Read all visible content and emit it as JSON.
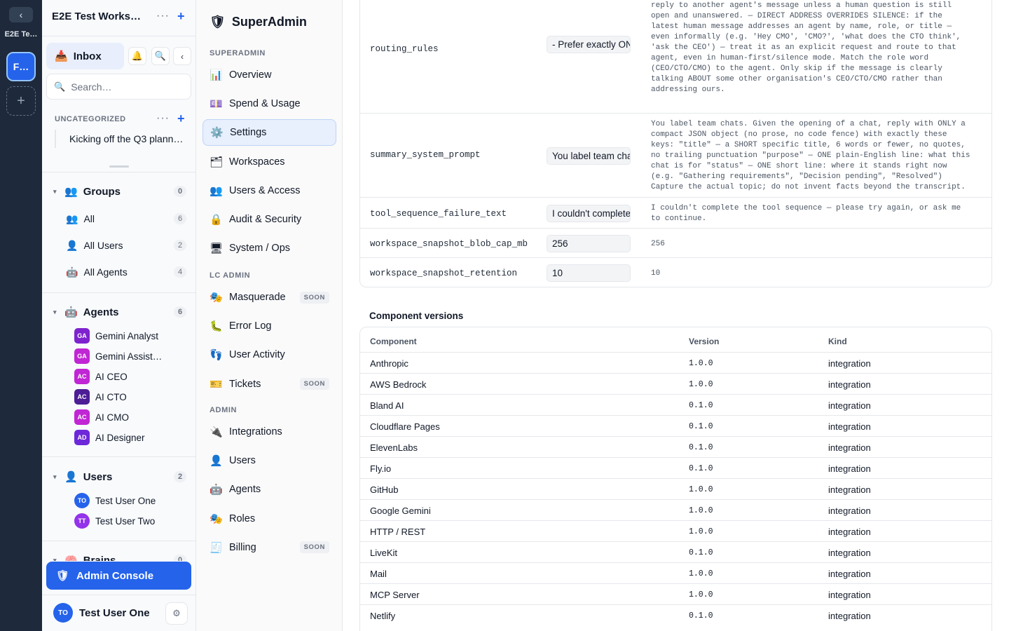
{
  "rail": {
    "collapse_glyph": "‹",
    "workspace_label": "E2E Te…",
    "workspace_initials": "F…",
    "add_glyph": "+"
  },
  "sidebar": {
    "workspace_title": "E2E Test Works…",
    "inbox_label": "Inbox",
    "search_placeholder": "Search…",
    "uncategorized_label": "UNCATEGORIZED",
    "conversation": "Kicking off the Q3 planni…",
    "groups": {
      "label": "Groups",
      "count": "0",
      "items": [
        {
          "label": "All",
          "count": "6"
        },
        {
          "label": "All Users",
          "count": "2"
        },
        {
          "label": "All Agents",
          "count": "4"
        }
      ]
    },
    "agents": {
      "label": "Agents",
      "count": "6",
      "items": [
        {
          "initials": "GA",
          "label": "Gemini Analyst",
          "color": "#7e22ce"
        },
        {
          "initials": "GA",
          "label": "Gemini Assist…",
          "color": "#c026d3"
        },
        {
          "initials": "AC",
          "label": "AI CEO",
          "color": "#c026d3"
        },
        {
          "initials": "AC",
          "label": "AI CTO",
          "color": "#4c1d95"
        },
        {
          "initials": "AC",
          "label": "AI CMO",
          "color": "#c026d3"
        },
        {
          "initials": "AD",
          "label": "AI Designer",
          "color": "#6d28d9"
        }
      ]
    },
    "users": {
      "label": "Users",
      "count": "2",
      "items": [
        {
          "initials": "TO",
          "label": "Test User One",
          "color": "#2563eb"
        },
        {
          "initials": "TT",
          "label": "Test User Two",
          "color": "#9333ea"
        }
      ]
    },
    "brains": {
      "label": "Brains",
      "count": "0"
    },
    "admin_console": "Admin Console",
    "user": {
      "initials": "TO",
      "name": "Test User One"
    }
  },
  "nav": {
    "brand": "SuperAdmin",
    "sections": [
      {
        "label": "SUPERADMIN",
        "items": [
          {
            "icon": "📊",
            "label": "Overview"
          },
          {
            "icon": "💷",
            "label": "Spend & Usage"
          },
          {
            "icon": "⚙️",
            "label": "Settings",
            "active": true
          },
          {
            "icon": "🗂",
            "label": "Workspaces"
          },
          {
            "icon": "👥",
            "label": "Users & Access"
          },
          {
            "icon": "🔒",
            "label": "Audit & Security"
          },
          {
            "icon": "🖥",
            "label": "System / Ops"
          }
        ]
      },
      {
        "label": "LC ADMIN",
        "items": [
          {
            "icon": "🎭",
            "label": "Masquerade",
            "badge": "SOON"
          },
          {
            "icon": "🐛",
            "label": "Error Log"
          },
          {
            "icon": "👣",
            "label": "User Activity"
          },
          {
            "icon": "🎫",
            "label": "Tickets",
            "badge": "SOON"
          }
        ]
      },
      {
        "label": "ADMIN",
        "items": [
          {
            "icon": "🔌",
            "label": "Integrations"
          },
          {
            "icon": "👤",
            "label": "Users"
          },
          {
            "icon": "🤖",
            "label": "Agents"
          },
          {
            "icon": "🎭",
            "label": "Roles"
          },
          {
            "icon": "🧾",
            "label": "Billing",
            "badge": "SOON"
          }
        ]
      }
    ]
  },
  "settings": [
    {
      "key": "routing_rules",
      "input": "- Prefer exactly ON",
      "value": "has something materially useful to add. — Never route an agent to\nreply to another agent's message unless a human question is still\nopen and unanswered. — DIRECT ADDRESS OVERRIDES SILENCE: if the\nlatest human message addresses an agent by name, role, or title —\neven informally (e.g. 'Hey CMO', 'CMO?', 'what does the CTO think',\n'ask the CEO') — treat it as an explicit request and route to that\nagent, even in human-first/silence mode. Match the role word\n(CEO/CTO/CMO) to the agent. Only skip if the message is clearly\ntalking ABOUT some other organisation's CEO/CTO/CMO rather than\naddressing ours."
    },
    {
      "key": "summary_system_prompt",
      "input": "You label team chats",
      "value": "You label team chats. Given the opening of a chat, reply with ONLY a\ncompact JSON object (no prose, no code fence) with exactly these\nkeys: \"title\" — a SHORT specific title, 6 words or fewer, no quotes,\nno trailing punctuation \"purpose\" — ONE plain-English line: what this\nchat is for \"status\" — ONE short line: where it stands right now\n(e.g. \"Gathering requirements\", \"Decision pending\", \"Resolved\")\nCapture the actual topic; do not invent facts beyond the transcript."
    },
    {
      "key": "tool_sequence_failure_text",
      "input": "I couldn't complete",
      "value": "I couldn't complete the tool sequence — please try again, or ask me\nto continue."
    },
    {
      "key": "workspace_snapshot_blob_cap_mb",
      "input": "256",
      "value": "256"
    },
    {
      "key": "workspace_snapshot_retention",
      "input": "10",
      "value": "10"
    }
  ],
  "components": {
    "title": "Component versions",
    "headers": [
      "Component",
      "Version",
      "Kind"
    ],
    "rows": [
      [
        "Anthropic",
        "1.0.0",
        "integration"
      ],
      [
        "AWS Bedrock",
        "1.0.0",
        "integration"
      ],
      [
        "Bland AI",
        "0.1.0",
        "integration"
      ],
      [
        "Cloudflare Pages",
        "0.1.0",
        "integration"
      ],
      [
        "ElevenLabs",
        "0.1.0",
        "integration"
      ],
      [
        "Fly.io",
        "0.1.0",
        "integration"
      ],
      [
        "GitHub",
        "1.0.0",
        "integration"
      ],
      [
        "Google Gemini",
        "1.0.0",
        "integration"
      ],
      [
        "HTTP / REST",
        "1.0.0",
        "integration"
      ],
      [
        "LiveKit",
        "0.1.0",
        "integration"
      ],
      [
        "Mail",
        "1.0.0",
        "integration"
      ],
      [
        "MCP Server",
        "1.0.0",
        "integration"
      ],
      [
        "Netlify",
        "0.1.0",
        "integration"
      ]
    ]
  }
}
